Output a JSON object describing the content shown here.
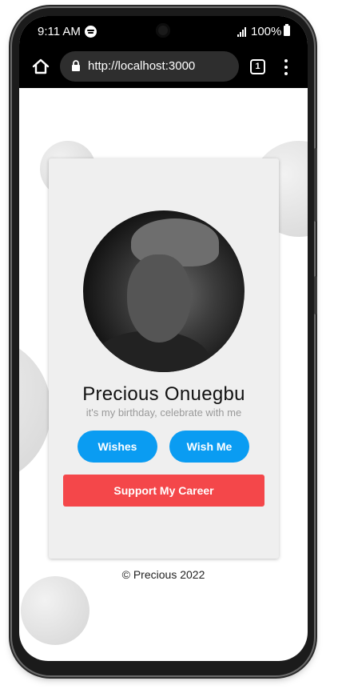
{
  "status_bar": {
    "time": "9:11 AM",
    "battery": "100%"
  },
  "browser": {
    "url": "http://localhost:3000",
    "tab_count": "1"
  },
  "profile": {
    "name": "Precious Onuegbu",
    "tagline": "it's my birthday, celebrate with me"
  },
  "buttons": {
    "wishes": "Wishes",
    "wish_me": "Wish Me",
    "support": "Support My Career"
  },
  "footer": {
    "text": "© Precious 2022"
  },
  "colors": {
    "primary_button": "#0a9cf2",
    "support_button": "#f4474a",
    "card_background": "#efefef"
  }
}
